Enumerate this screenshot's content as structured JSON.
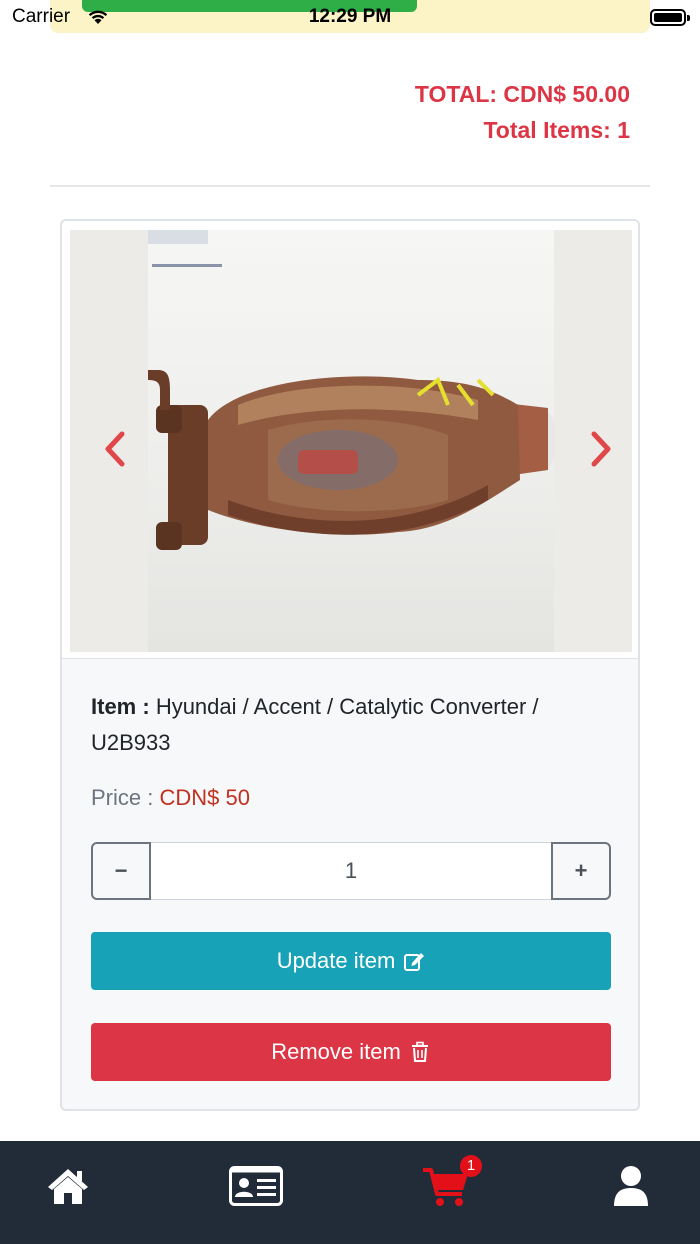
{
  "status_bar": {
    "carrier": "Carrier",
    "time": "12:29 PM"
  },
  "cart_summary": {
    "total": "TOTAL: CDN$ 50.00",
    "total_items": "Total Items: 1"
  },
  "cart_item": {
    "image_icon": "product-photo",
    "item_label": "Item :",
    "item_value": "Hyundai / Accent / Catalytic Converter / U2B933",
    "price_label": "Price :",
    "price_value": "CDN$ 50",
    "quantity": "1",
    "decrement_label": "−",
    "increment_label": "+",
    "update_label": "Update item",
    "remove_label": "Remove item"
  },
  "bottom_nav": {
    "items": [
      {
        "icon": "home-icon"
      },
      {
        "icon": "id-card-icon"
      },
      {
        "icon": "cart-icon",
        "badge": "1"
      },
      {
        "icon": "user-icon"
      }
    ]
  },
  "colors": {
    "danger": "#dc3545",
    "info": "#17a2b8",
    "nav_bg": "#222b38",
    "cart_active": "#e3101a"
  }
}
